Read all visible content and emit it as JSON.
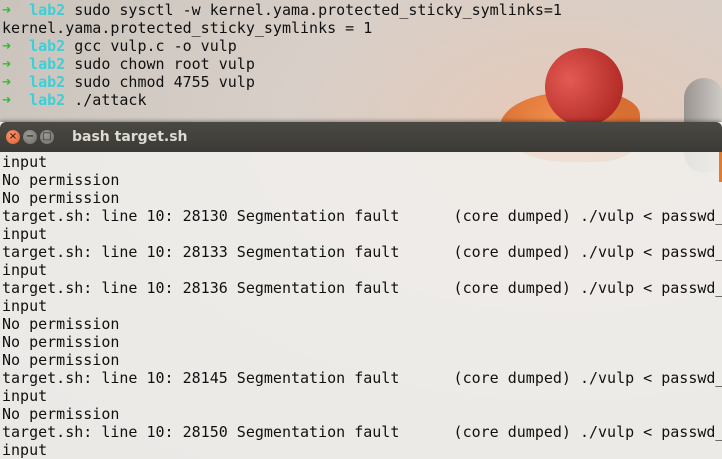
{
  "back_terminal": {
    "lines": [
      {
        "arrow": "➜",
        "dir": "lab2",
        "cmd": "sudo sysctl -w kernel.yama.protected_sticky_symlinks=1"
      },
      {
        "arrow": "",
        "dir": "",
        "cmd": "kernel.yama.protected_sticky_symlinks = 1"
      },
      {
        "arrow": "➜",
        "dir": "lab2",
        "cmd": "gcc vulp.c -o vulp"
      },
      {
        "arrow": "➜",
        "dir": "lab2",
        "cmd": "sudo chown root vulp"
      },
      {
        "arrow": "➜",
        "dir": "lab2",
        "cmd": "sudo chmod 4755 vulp"
      },
      {
        "arrow": "➜",
        "dir": "lab2",
        "cmd": "./attack"
      }
    ]
  },
  "window": {
    "title": "bash target.sh",
    "buttons": {
      "close": "×",
      "minimize": "−",
      "maximize": "□"
    }
  },
  "front_terminal": {
    "lines": [
      "input",
      "No permission",
      "No permission",
      "target.sh: line 10: 28130 Segmentation fault      (core dumped) ./vulp < passwd_",
      "input",
      "target.sh: line 10: 28133 Segmentation fault      (core dumped) ./vulp < passwd_",
      "input",
      "target.sh: line 10: 28136 Segmentation fault      (core dumped) ./vulp < passwd_",
      "input",
      "No permission",
      "No permission",
      "No permission",
      "target.sh: line 10: 28145 Segmentation fault      (core dumped) ./vulp < passwd_",
      "input",
      "No permission",
      "target.sh: line 10: 28150 Segmentation fault      (core dumped) ./vulp < passwd_",
      "input"
    ]
  },
  "colors": {
    "prompt_arrow": "#2fbf2f",
    "prompt_dir": "#3ad0d8",
    "titlebar": "#3b3a36",
    "close_button": "#e0582a"
  }
}
